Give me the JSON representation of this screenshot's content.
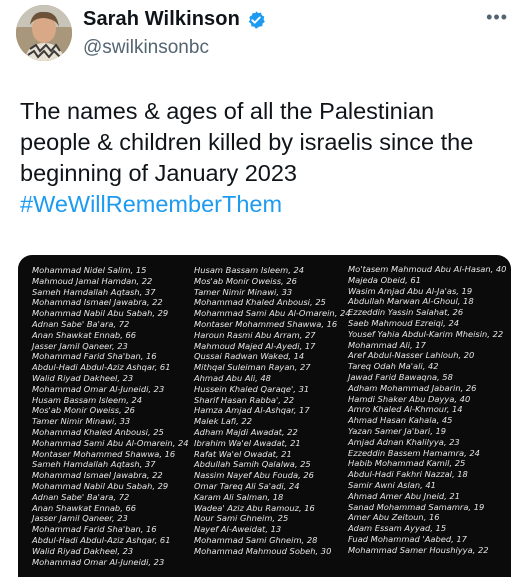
{
  "author": {
    "name": "Sarah Wilkinson",
    "handle": "@swilkinsonbc",
    "verified": true
  },
  "menu": {
    "label": "•••"
  },
  "tweet": {
    "text": "The names & ages of all the Palestinian people & children killed by israelis since the beginning of January 2023",
    "hashtag": "#WeWillRememberThem"
  },
  "colors": {
    "hashtag": "#1d9bf0",
    "verified_badge": "#1d9bf0"
  },
  "image_list": {
    "column1": [
      "Mohammad Nidel Salim, 15",
      "Mahmoud Jamal Hamdan, 22",
      "Sameh Hamdallah Aqtash, 37",
      "Mohammad Ismael Jawabra, 22",
      "Mohammad Nabil Abu Sabah, 29",
      "Adnan Sabe' Ba'ara, 72",
      "Anan Shawkat Ennab, 66",
      "Jasser Jamil Qaneer, 23",
      "Mohammad Farid Sha'ban, 16",
      "Abdul-Hadi Abdul-Aziz Ashqar, 61",
      "Walid Riyad Dakheel, 23",
      "Mohammad Omar Al-Juneidi, 23",
      "Husam Bassam Isleem, 24",
      "Mos'ab Monir Oweiss, 26",
      "Tamer Nimir Minawi, 33",
      "Mohammad Khaled Anbousi, 25",
      "Mohammad Sami Abu Al-Omarein, 24",
      "Montaser Mohammed Shawwa, 16",
      "Sameh Hamdallah Aqtash, 37",
      "Mohammad Ismael Jawabra, 22",
      "Mohammad Nabil Abu Sabah, 29",
      "Adnan Sabe' Ba'ara, 72",
      "Anan Shawkat Ennab, 66",
      "Jasser Jamil Qaneer, 23",
      "Mohammad Farid Sha'ban, 16",
      "Abdul-Hadi Abdul-Aziz Ashqar, 61",
      "Walid Riyad Dakheel, 23",
      "Mohammad Omar Al-Juneidi, 23"
    ],
    "column2": [
      "Husam Bassam Isleem, 24",
      "Mos'ab Monir Oweiss, 26",
      "Tamer Nimir Minawi, 33",
      "Mohammad Khaled Anbousi, 25",
      "Mohammad Sami Abu Al-Omarein, 24",
      "Montaser Mohammed Shawwa, 16",
      "Haroun Rasmi Abu Arram, 27",
      "Mahmoud Majed Al-Ayedi, 17",
      "Qussai Radwan Waked, 14",
      "Mithqal Suleiman Rayan, 27",
      "Ahmad Abu Ali, 48",
      "Hussein Khaled Qaraqe', 31",
      "Sharif Hasan Rabba', 22",
      "Hamza Amjad Al-Ashqar, 17",
      "Malek Lafi, 22",
      "Adham Majdi Awadat, 22",
      "Ibrahim Wa'el Awadat, 21",
      "Rafat Wa'el Owadat, 21",
      "Abdullah Samih Qalalwa, 25",
      "Nassim Nayef Abu Fouda, 26",
      "Omar Tareq Ali Sa'adi, 24",
      "Karam Ali Salman, 18",
      "Wadea' Aziz Abu Ramouz, 16",
      "Nour Sami Ghneim, 25",
      "Nayef Al-Aweidat, 13",
      "Mohammad Sami Ghneim, 28",
      "Mohammad Mahmoud Sobeh, 30"
    ],
    "column3": [
      "Mo'tasem Mahmoud Abu Al-Hasan, 40",
      "Majeda Obeid, 61",
      "Wasim Amjad Abu Al-Ja'as, 19",
      "Abdullah Marwan Al-Ghoul, 18",
      "Ezzeddin Yassin Salahat, 26",
      "Saeb Mahmoud Ezreiqi, 24",
      "Yousef Yahia Abdul-Karim Mheisin, 22",
      "Mohammad Ali, 17",
      "Aref Abdul-Nasser Lahlouh, 20",
      "Tareq Odah Ma'ali, 42",
      "Jawad Farid Bawaqna, 58",
      "Adham Mohammad Jabarin, 26",
      "Hamdi Shaker Abu Dayya, 40",
      "Amro Khaled Al-Khmour, 14",
      "Ahmad Hasan Kahala, 45",
      "Yazan Samer Ja'bari, 19",
      "Amjad Adnan Khalilyya, 23",
      "Ezzeddin Bassem Hamamra, 24",
      "Habib Mohammad Kamil, 25",
      "Abdul-Hadi Fakhri Nazzal, 18",
      "Samir Awni Aslan, 41",
      "Ahmad Amer Abu Jneid, 21",
      "Sanad Mohammad Samamra, 19",
      "Amer Abu Zeitoun, 16",
      "Adam Essam Ayyad, 15",
      "Fuad Mohammad 'Aabed, 17",
      "Mohammad Samer Houshiyya, 22"
    ]
  }
}
